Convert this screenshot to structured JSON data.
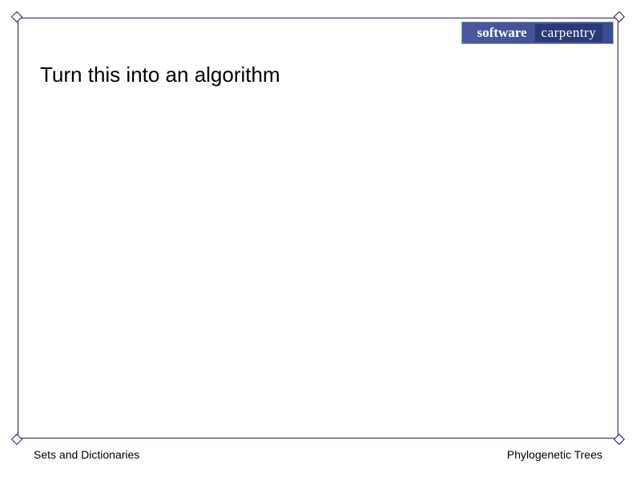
{
  "logo": {
    "left": "software",
    "right": "carpentry"
  },
  "heading": "Turn this into an algorithm",
  "footer": {
    "left": "Sets and Dictionaries",
    "right": "Phylogenetic Trees"
  }
}
